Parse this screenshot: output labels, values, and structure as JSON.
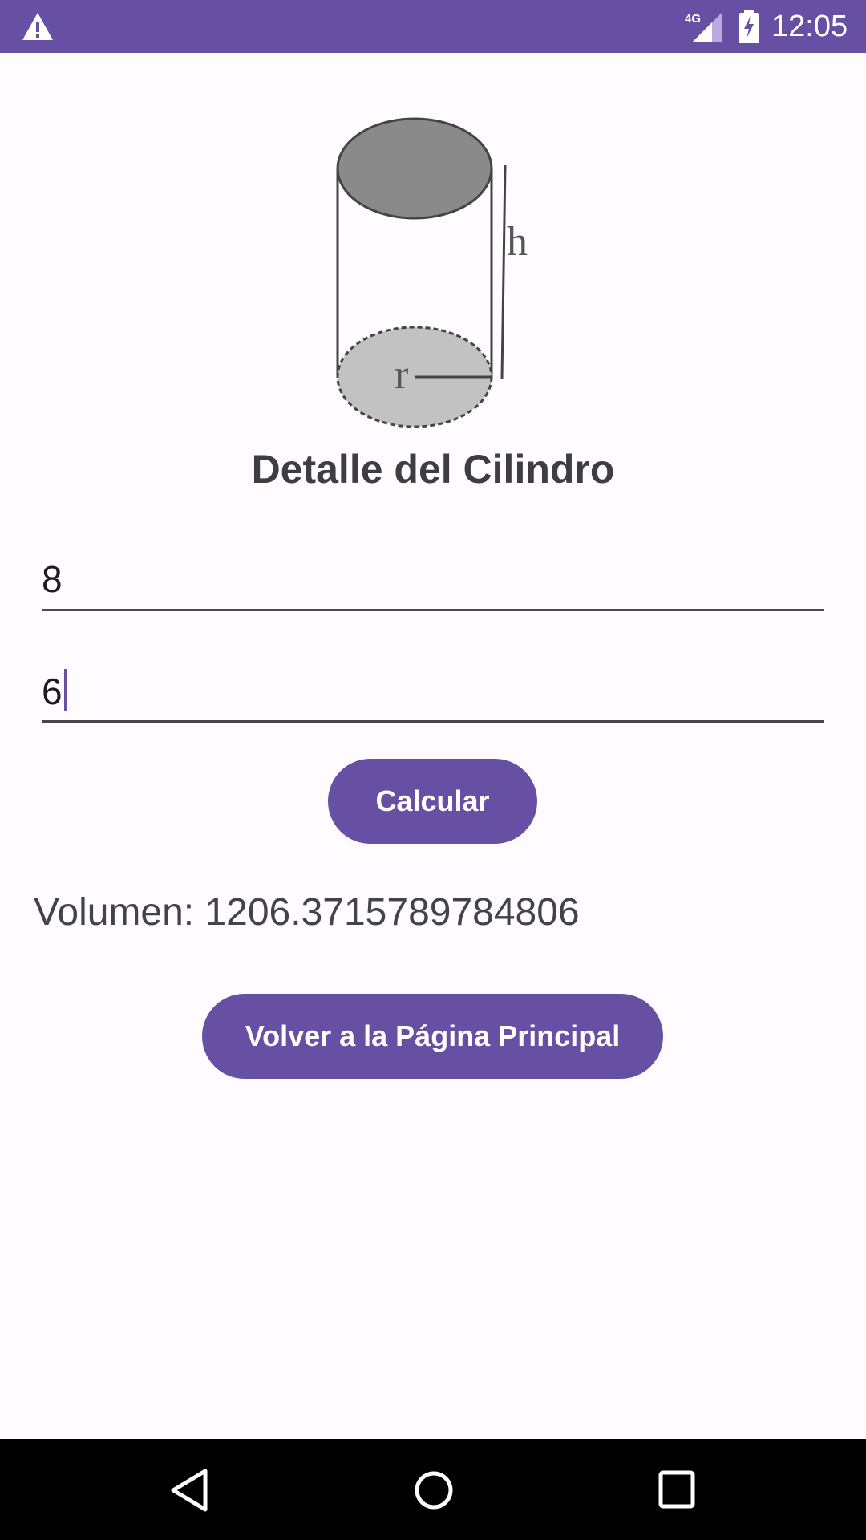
{
  "status_bar": {
    "network_label": "4G",
    "time": "12:05",
    "icons": [
      "warning-icon",
      "signal-icon",
      "battery-charging-icon"
    ],
    "color": "#6750a4"
  },
  "figure": {
    "height_label": "h",
    "radius_label": "r"
  },
  "title": "Detalle del Cilindro",
  "fields": {
    "first_value": "8",
    "second_value": "6"
  },
  "buttons": {
    "calculate_label": "Calcular",
    "back_label": "Volver a la Página Principal"
  },
  "result_text": "Volumen: 1206.3715789784806",
  "nav_bar": {
    "icons": [
      "back-icon",
      "home-icon",
      "recents-icon"
    ]
  },
  "colors": {
    "primary": "#6750a4",
    "background": "#fffbfe",
    "text_dark": "#1d1b20"
  }
}
